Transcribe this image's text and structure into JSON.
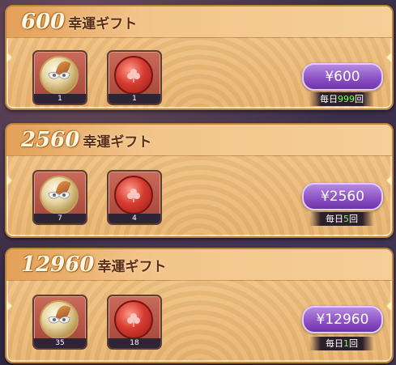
{
  "offers": [
    {
      "amount": "600",
      "label": "幸運ギフト",
      "items": [
        {
          "icon": "mask-coin-icon",
          "count": "1"
        },
        {
          "icon": "clover-coin-icon",
          "count": "1"
        }
      ],
      "price": "¥600",
      "limit_prefix": "毎日",
      "limit_num": "999",
      "limit_suffix": "回"
    },
    {
      "amount": "2560",
      "label": "幸運ギフト",
      "items": [
        {
          "icon": "mask-coin-icon",
          "count": "7"
        },
        {
          "icon": "clover-coin-icon",
          "count": "4"
        }
      ],
      "price": "¥2560",
      "limit_prefix": "毎日",
      "limit_num": "5",
      "limit_suffix": "回"
    },
    {
      "amount": "12960",
      "label": "幸運ギフト",
      "items": [
        {
          "icon": "mask-coin-icon",
          "count": "35"
        },
        {
          "icon": "clover-coin-icon",
          "count": "18"
        }
      ],
      "price": "¥12960",
      "limit_prefix": "毎日",
      "limit_num": "1",
      "limit_suffix": "回"
    }
  ]
}
